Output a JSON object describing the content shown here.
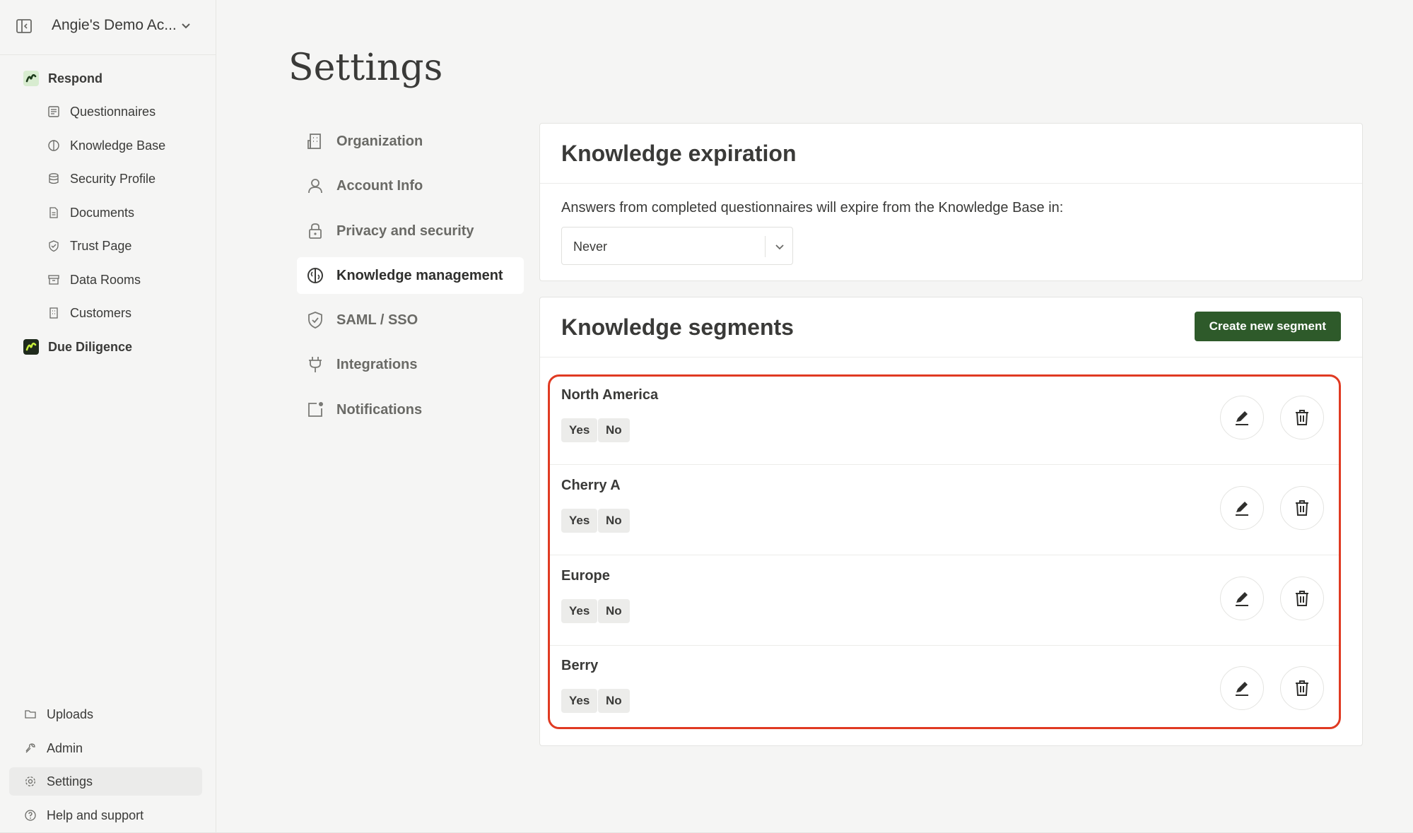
{
  "sidebar": {
    "account_name": "Angie's Demo Ac...",
    "nav": [
      {
        "label": "Respond",
        "icon": "respond-logo-icon"
      },
      {
        "label": "Questionnaires",
        "icon": "list-icon"
      },
      {
        "label": "Knowledge Base",
        "icon": "brain-icon"
      },
      {
        "label": "Security Profile",
        "icon": "database-icon"
      },
      {
        "label": "Documents",
        "icon": "document-icon"
      },
      {
        "label": "Trust Page",
        "icon": "shield-check-icon"
      },
      {
        "label": "Data Rooms",
        "icon": "archive-icon"
      },
      {
        "label": "Customers",
        "icon": "building-icon"
      },
      {
        "label": "Due Diligence",
        "icon": "due-diligence-logo-icon"
      }
    ],
    "bottom": [
      {
        "label": "Uploads",
        "icon": "folder-icon"
      },
      {
        "label": "Admin",
        "icon": "wrench-icon"
      },
      {
        "label": "Settings",
        "icon": "gear-icon"
      },
      {
        "label": "Help and support",
        "icon": "help-icon"
      }
    ]
  },
  "page_title": "Settings",
  "settings_menu": [
    {
      "label": "Organization",
      "icon": "building-icon"
    },
    {
      "label": "Account Info",
      "icon": "user-icon"
    },
    {
      "label": "Privacy and security",
      "icon": "lock-icon"
    },
    {
      "label": "Knowledge management",
      "icon": "brain-icon"
    },
    {
      "label": "SAML / SSO",
      "icon": "shield-check-icon"
    },
    {
      "label": "Integrations",
      "icon": "plug-icon"
    },
    {
      "label": "Notifications",
      "icon": "notification-icon"
    }
  ],
  "expiration": {
    "title": "Knowledge expiration",
    "description": "Answers from completed questionnaires will expire from the Knowledge Base in:",
    "selected": "Never"
  },
  "segments": {
    "title": "Knowledge segments",
    "create_label": "Create new segment",
    "items": [
      {
        "name": "North America",
        "yes": "Yes",
        "no": "No"
      },
      {
        "name": "Cherry A",
        "yes": "Yes",
        "no": "No"
      },
      {
        "name": "Europe",
        "yes": "Yes",
        "no": "No"
      },
      {
        "name": "Berry",
        "yes": "Yes",
        "no": "No"
      }
    ]
  },
  "colors": {
    "accent": "#2e5a2a",
    "highlight": "#e03a22",
    "logo_green": "#c8f03c"
  }
}
